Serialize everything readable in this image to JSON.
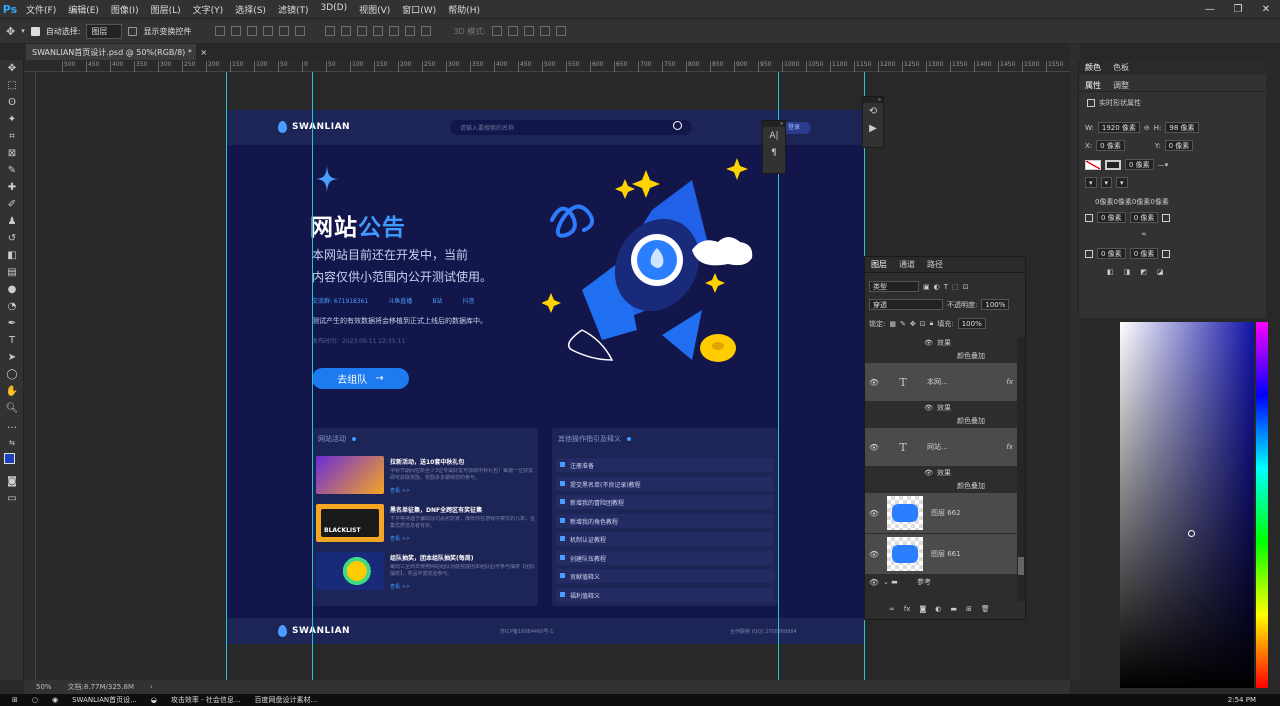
{
  "app": {
    "logo": "Ps"
  },
  "menu": [
    "文件(F)",
    "编辑(E)",
    "图像(I)",
    "图层(L)",
    "文字(Y)",
    "选择(S)",
    "滤镜(T)",
    "3D(D)",
    "视图(V)",
    "窗口(W)",
    "帮助(H)"
  ],
  "options": {
    "auto_select_label": "自动选择:",
    "auto_select_value": "图层",
    "transform_label": "显示变换控件",
    "mode_3d": "3D 模式:"
  },
  "document": {
    "tab_title": "SWANLIAN首页设计.psd @ 50%(RGB/8) *",
    "zoom": "50%",
    "doc_size": "文档:8.77M/325.8M"
  },
  "ruler": [
    "500",
    "450",
    "400",
    "350",
    "300",
    "250",
    "200",
    "150",
    "100",
    "50",
    "0",
    "50",
    "100",
    "150",
    "200",
    "250",
    "300",
    "350",
    "400",
    "450",
    "500",
    "550",
    "600",
    "650",
    "700",
    "750",
    "800",
    "850",
    "900",
    "950",
    "1000",
    "1050",
    "1100",
    "1150",
    "1200",
    "1250",
    "1300",
    "1350",
    "1400",
    "1450",
    "1500",
    "1550",
    "1600",
    "1650",
    "1700",
    "1750"
  ],
  "site": {
    "logo_text": "SWANLIAN",
    "search_placeholder": "请输入要搜索的名称",
    "login": "登录",
    "title_white": "网站",
    "title_blue": "公告",
    "sub1": "本网站目前还在开发中，当前",
    "sub2": "内容仅供小范围内公开测试使用。",
    "contacts": [
      "交流群: 671918361",
      "斗鱼直播",
      "B站",
      "抖音"
    ],
    "desc": "测试产生的有效数据将会移植到正式上线后的数据库中。",
    "date": "发布时间：2023.09.11  22:35:11",
    "join_btn": "去组队",
    "activities_title": "网站活动",
    "activities": [
      {
        "title": "拉新活动，送10套中秋礼包",
        "desc": "中秋节期间拉新至少3位专属好友可领取中秋礼包！每邀一位好友即可获取奖励，奖励多多期待您的参与。",
        "more": "查看 >>"
      },
      {
        "title": "黑名单征集，DNF全跨区有奖征集",
        "desc": "不平等待遇于骗局惩罚恶劣玩家，降低你在游戏中被坑的几率，征集优质信息者有奖。",
        "more": "查看 >>"
      },
      {
        "title": "组队抽奖，团本组队抽奖(每周)",
        "desc": "每周三至周日使用网站组队功能完成团本组队后可参与抽奖【团队抽奖】，奖品丰富欢迎参与。",
        "more": "查看 >>"
      }
    ],
    "blacklist_label": "BLACKLIST",
    "guides_title": "其他操作指引及释义",
    "guides": [
      "注册准备",
      "提交黑名单(不良记录)教程",
      "新增我的冒险团教程",
      "新增我的角色教程",
      "机制认证教程",
      "创建队伍教程",
      "贡献值释义",
      "福利值释义"
    ],
    "footer_icp": "苏ICP备16064460号-1",
    "footer_contact": "合作联络    (QQ) 2700369884"
  },
  "props_panel": {
    "tabs": [
      "颜色",
      "色板"
    ],
    "sub_tabs": [
      "属性",
      "调整"
    ],
    "header": "实时形状属性",
    "w_label": "W:",
    "w_value": "1920 像素",
    "h_label": "H:",
    "h_value": "98 像素",
    "x_label": "X:",
    "x_value": "0 像素",
    "y_label": "Y:",
    "y_value": "0 像素",
    "stroke": "0 像素",
    "radius_all": "0像素0像素0像素0像素",
    "r1": "0 像素",
    "r2": "0 像素",
    "r3": "0 像素",
    "r4": "0 像素"
  },
  "layers_panel": {
    "tabs": [
      "图层",
      "通道",
      "路径"
    ],
    "kind": "类型",
    "blend": "穿透",
    "opacity_label": "不透明度:",
    "opacity": "100%",
    "lock_label": "锁定:",
    "fill_label": "填充:",
    "fill": "100%",
    "rows": [
      {
        "kind": "effect",
        "label": "效果"
      },
      {
        "kind": "effect-item",
        "label": "颜色叠加"
      },
      {
        "kind": "text",
        "label": "本网..."
      },
      {
        "kind": "effect",
        "label": "效果"
      },
      {
        "kind": "effect-item",
        "label": "颜色叠加"
      },
      {
        "kind": "text",
        "label": "网站..."
      },
      {
        "kind": "effect",
        "label": "效果"
      },
      {
        "kind": "effect-item",
        "label": "颜色叠加"
      },
      {
        "kind": "image",
        "label": "图层 662"
      },
      {
        "kind": "image",
        "label": "图层 661"
      },
      {
        "kind": "folder",
        "label": "参考"
      }
    ]
  },
  "mini_char": [
    "A|",
    "¶"
  ],
  "taskbar": {
    "items": [
      "SWANLIAN首页设...",
      "攻击效率 - 社会信息...",
      "百度网盘设计素材..."
    ],
    "time": "2:54 PM"
  }
}
